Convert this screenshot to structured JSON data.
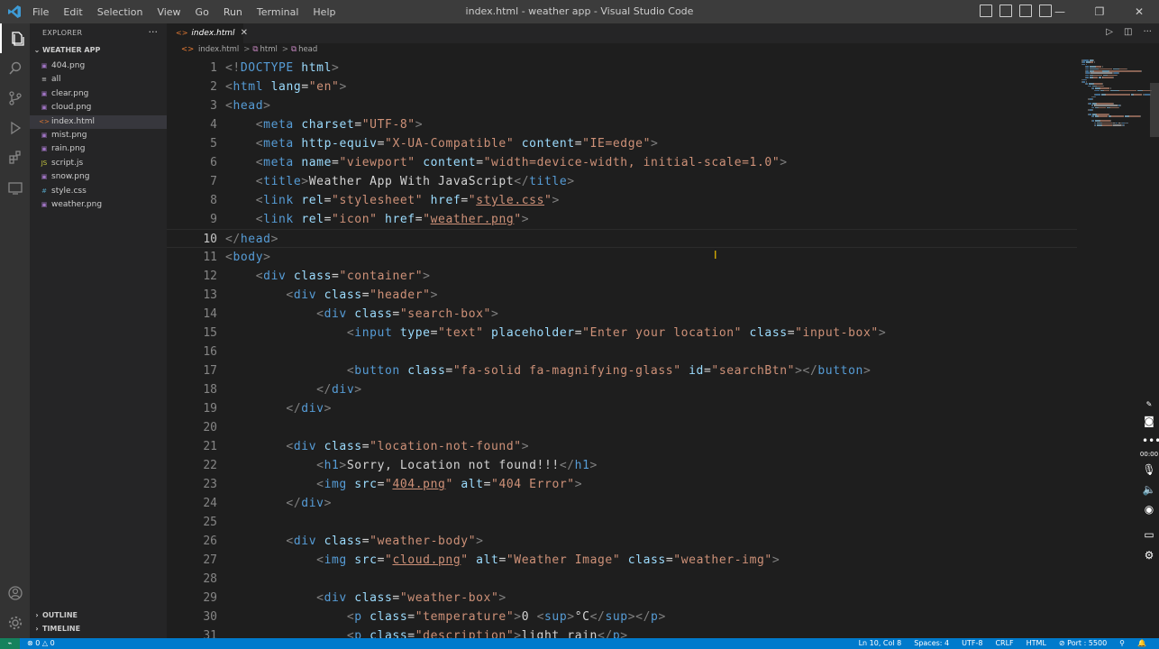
{
  "menu": [
    "File",
    "Edit",
    "Selection",
    "View",
    "Go",
    "Run",
    "Terminal",
    "Help"
  ],
  "window_title": "index.html - weather app - Visual Studio Code",
  "window_controls": {
    "minimize": "—",
    "restore": "❐",
    "close": "✕"
  },
  "sidebar": {
    "title": "EXPLORER",
    "more": "···",
    "folder": "WEATHER APP",
    "files": [
      {
        "name": "404.png",
        "icon": "▣"
      },
      {
        "name": "all",
        "icon": "≡"
      },
      {
        "name": "clear.png",
        "icon": "▣"
      },
      {
        "name": "cloud.png",
        "icon": "▣"
      },
      {
        "name": "index.html",
        "icon": "<>"
      },
      {
        "name": "mist.png",
        "icon": "▣"
      },
      {
        "name": "rain.png",
        "icon": "▣"
      },
      {
        "name": "script.js",
        "icon": "JS"
      },
      {
        "name": "snow.png",
        "icon": "▣"
      },
      {
        "name": "style.css",
        "icon": "#"
      },
      {
        "name": "weather.png",
        "icon": "▣"
      }
    ],
    "outline": "OUTLINE",
    "timeline": "TIMELINE"
  },
  "tab": {
    "label": "index.html",
    "icon": "<>",
    "close": "✕"
  },
  "breadcrumb": {
    "file": "index.html",
    "sep": ">",
    "b1": "html",
    "b2": "head"
  },
  "code_lines": [
    {
      "n": "1",
      "tokens": [
        [
          "p",
          "<!"
        ],
        [
          "t",
          "DOCTYPE"
        ],
        [
          "x",
          " "
        ],
        [
          "a",
          "html"
        ],
        [
          "p",
          ">"
        ]
      ]
    },
    {
      "n": "2",
      "tokens": [
        [
          "p",
          "<"
        ],
        [
          "t",
          "html"
        ],
        [
          "x",
          " "
        ],
        [
          "a",
          "lang"
        ],
        [
          "x",
          "="
        ],
        [
          "s",
          "\"en\""
        ],
        [
          "p",
          ">"
        ]
      ]
    },
    {
      "n": "3",
      "tokens": [
        [
          "p",
          "<"
        ],
        [
          "t",
          "head"
        ],
        [
          "p",
          ">"
        ]
      ]
    },
    {
      "n": "4",
      "tokens": [
        [
          "x",
          "    "
        ],
        [
          "p",
          "<"
        ],
        [
          "t",
          "meta"
        ],
        [
          "x",
          " "
        ],
        [
          "a",
          "charset"
        ],
        [
          "x",
          "="
        ],
        [
          "s",
          "\"UTF-8\""
        ],
        [
          "p",
          ">"
        ]
      ]
    },
    {
      "n": "5",
      "tokens": [
        [
          "x",
          "    "
        ],
        [
          "p",
          "<"
        ],
        [
          "t",
          "meta"
        ],
        [
          "x",
          " "
        ],
        [
          "a",
          "http-equiv"
        ],
        [
          "x",
          "="
        ],
        [
          "s",
          "\"X-UA-Compatible\""
        ],
        [
          "x",
          " "
        ],
        [
          "a",
          "content"
        ],
        [
          "x",
          "="
        ],
        [
          "s",
          "\"IE=edge\""
        ],
        [
          "p",
          ">"
        ]
      ]
    },
    {
      "n": "6",
      "tokens": [
        [
          "x",
          "    "
        ],
        [
          "p",
          "<"
        ],
        [
          "t",
          "meta"
        ],
        [
          "x",
          " "
        ],
        [
          "a",
          "name"
        ],
        [
          "x",
          "="
        ],
        [
          "s",
          "\"viewport\""
        ],
        [
          "x",
          " "
        ],
        [
          "a",
          "content"
        ],
        [
          "x",
          "="
        ],
        [
          "s",
          "\"width=device-width, initial-scale=1.0\""
        ],
        [
          "p",
          ">"
        ]
      ]
    },
    {
      "n": "7",
      "tokens": [
        [
          "x",
          "    "
        ],
        [
          "p",
          "<"
        ],
        [
          "t",
          "title"
        ],
        [
          "p",
          ">"
        ],
        [
          "x",
          "Weather App With JavaScript"
        ],
        [
          "p",
          "</"
        ],
        [
          "t",
          "title"
        ],
        [
          "p",
          ">"
        ]
      ]
    },
    {
      "n": "8",
      "tokens": [
        [
          "x",
          "    "
        ],
        [
          "p",
          "<"
        ],
        [
          "t",
          "link"
        ],
        [
          "x",
          " "
        ],
        [
          "a",
          "rel"
        ],
        [
          "x",
          "="
        ],
        [
          "s",
          "\"stylesheet\""
        ],
        [
          "x",
          " "
        ],
        [
          "a",
          "href"
        ],
        [
          "x",
          "="
        ],
        [
          "s",
          "\""
        ],
        [
          "u",
          "style.css"
        ],
        [
          "s",
          "\""
        ],
        [
          "p",
          ">"
        ]
      ]
    },
    {
      "n": "9",
      "tokens": [
        [
          "x",
          "    "
        ],
        [
          "p",
          "<"
        ],
        [
          "t",
          "link"
        ],
        [
          "x",
          " "
        ],
        [
          "a",
          "rel"
        ],
        [
          "x",
          "="
        ],
        [
          "s",
          "\"icon\""
        ],
        [
          "x",
          " "
        ],
        [
          "a",
          "href"
        ],
        [
          "x",
          "="
        ],
        [
          "s",
          "\""
        ],
        [
          "u",
          "weather.png"
        ],
        [
          "s",
          "\""
        ],
        [
          "p",
          ">"
        ]
      ]
    },
    {
      "n": "10",
      "tokens": [
        [
          "p",
          "</"
        ],
        [
          "t",
          "head"
        ],
        [
          "p",
          ">"
        ]
      ]
    },
    {
      "n": "11",
      "tokens": [
        [
          "p",
          "<"
        ],
        [
          "t",
          "body"
        ],
        [
          "p",
          ">"
        ]
      ]
    },
    {
      "n": "12",
      "tokens": [
        [
          "x",
          "    "
        ],
        [
          "p",
          "<"
        ],
        [
          "t",
          "div"
        ],
        [
          "x",
          " "
        ],
        [
          "a",
          "class"
        ],
        [
          "x",
          "="
        ],
        [
          "s",
          "\"container\""
        ],
        [
          "p",
          ">"
        ]
      ]
    },
    {
      "n": "13",
      "tokens": [
        [
          "x",
          "        "
        ],
        [
          "p",
          "<"
        ],
        [
          "t",
          "div"
        ],
        [
          "x",
          " "
        ],
        [
          "a",
          "class"
        ],
        [
          "x",
          "="
        ],
        [
          "s",
          "\"header\""
        ],
        [
          "p",
          ">"
        ]
      ]
    },
    {
      "n": "14",
      "tokens": [
        [
          "x",
          "            "
        ],
        [
          "p",
          "<"
        ],
        [
          "t",
          "div"
        ],
        [
          "x",
          " "
        ],
        [
          "a",
          "class"
        ],
        [
          "x",
          "="
        ],
        [
          "s",
          "\"search-box\""
        ],
        [
          "p",
          ">"
        ]
      ]
    },
    {
      "n": "15",
      "tokens": [
        [
          "x",
          "                "
        ],
        [
          "p",
          "<"
        ],
        [
          "t",
          "input"
        ],
        [
          "x",
          " "
        ],
        [
          "a",
          "type"
        ],
        [
          "x",
          "="
        ],
        [
          "s",
          "\"text\""
        ],
        [
          "x",
          " "
        ],
        [
          "a",
          "placeholder"
        ],
        [
          "x",
          "="
        ],
        [
          "s",
          "\"Enter your location\""
        ],
        [
          "x",
          " "
        ],
        [
          "a",
          "class"
        ],
        [
          "x",
          "="
        ],
        [
          "s",
          "\"input-box\""
        ],
        [
          "p",
          ">"
        ]
      ]
    },
    {
      "n": "16",
      "tokens": []
    },
    {
      "n": "17",
      "tokens": [
        [
          "x",
          "                "
        ],
        [
          "p",
          "<"
        ],
        [
          "t",
          "button"
        ],
        [
          "x",
          " "
        ],
        [
          "a",
          "class"
        ],
        [
          "x",
          "="
        ],
        [
          "s",
          "\"fa-solid fa-magnifying-glass\""
        ],
        [
          "x",
          " "
        ],
        [
          "a",
          "id"
        ],
        [
          "x",
          "="
        ],
        [
          "s",
          "\"searchBtn\""
        ],
        [
          "p",
          "></"
        ],
        [
          "t",
          "button"
        ],
        [
          "p",
          ">"
        ]
      ]
    },
    {
      "n": "18",
      "tokens": [
        [
          "x",
          "            "
        ],
        [
          "p",
          "</"
        ],
        [
          "t",
          "div"
        ],
        [
          "p",
          ">"
        ]
      ]
    },
    {
      "n": "19",
      "tokens": [
        [
          "x",
          "        "
        ],
        [
          "p",
          "</"
        ],
        [
          "t",
          "div"
        ],
        [
          "p",
          ">"
        ]
      ]
    },
    {
      "n": "20",
      "tokens": []
    },
    {
      "n": "21",
      "tokens": [
        [
          "x",
          "        "
        ],
        [
          "p",
          "<"
        ],
        [
          "t",
          "div"
        ],
        [
          "x",
          " "
        ],
        [
          "a",
          "class"
        ],
        [
          "x",
          "="
        ],
        [
          "s",
          "\"location-not-found\""
        ],
        [
          "p",
          ">"
        ]
      ]
    },
    {
      "n": "22",
      "tokens": [
        [
          "x",
          "            "
        ],
        [
          "p",
          "<"
        ],
        [
          "t",
          "h1"
        ],
        [
          "p",
          ">"
        ],
        [
          "x",
          "Sorry, Location not found!!!"
        ],
        [
          "p",
          "</"
        ],
        [
          "t",
          "h1"
        ],
        [
          "p",
          ">"
        ]
      ]
    },
    {
      "n": "23",
      "tokens": [
        [
          "x",
          "            "
        ],
        [
          "p",
          "<"
        ],
        [
          "t",
          "img"
        ],
        [
          "x",
          " "
        ],
        [
          "a",
          "src"
        ],
        [
          "x",
          "="
        ],
        [
          "s",
          "\""
        ],
        [
          "u",
          "404.png"
        ],
        [
          "s",
          "\""
        ],
        [
          "x",
          " "
        ],
        [
          "a",
          "alt"
        ],
        [
          "x",
          "="
        ],
        [
          "s",
          "\"404 Error\""
        ],
        [
          "p",
          ">"
        ]
      ]
    },
    {
      "n": "24",
      "tokens": [
        [
          "x",
          "        "
        ],
        [
          "p",
          "</"
        ],
        [
          "t",
          "div"
        ],
        [
          "p",
          ">"
        ]
      ]
    },
    {
      "n": "25",
      "tokens": []
    },
    {
      "n": "26",
      "tokens": [
        [
          "x",
          "        "
        ],
        [
          "p",
          "<"
        ],
        [
          "t",
          "div"
        ],
        [
          "x",
          " "
        ],
        [
          "a",
          "class"
        ],
        [
          "x",
          "="
        ],
        [
          "s",
          "\"weather-body\""
        ],
        [
          "p",
          ">"
        ]
      ]
    },
    {
      "n": "27",
      "tokens": [
        [
          "x",
          "            "
        ],
        [
          "p",
          "<"
        ],
        [
          "t",
          "img"
        ],
        [
          "x",
          " "
        ],
        [
          "a",
          "src"
        ],
        [
          "x",
          "="
        ],
        [
          "s",
          "\""
        ],
        [
          "u",
          "cloud.png"
        ],
        [
          "s",
          "\""
        ],
        [
          "x",
          " "
        ],
        [
          "a",
          "alt"
        ],
        [
          "x",
          "="
        ],
        [
          "s",
          "\"Weather Image\""
        ],
        [
          "x",
          " "
        ],
        [
          "a",
          "class"
        ],
        [
          "x",
          "="
        ],
        [
          "s",
          "\"weather-img\""
        ],
        [
          "p",
          ">"
        ]
      ]
    },
    {
      "n": "28",
      "tokens": []
    },
    {
      "n": "29",
      "tokens": [
        [
          "x",
          "            "
        ],
        [
          "p",
          "<"
        ],
        [
          "t",
          "div"
        ],
        [
          "x",
          " "
        ],
        [
          "a",
          "class"
        ],
        [
          "x",
          "="
        ],
        [
          "s",
          "\"weather-box\""
        ],
        [
          "p",
          ">"
        ]
      ]
    },
    {
      "n": "30",
      "tokens": [
        [
          "x",
          "                "
        ],
        [
          "p",
          "<"
        ],
        [
          "t",
          "p"
        ],
        [
          "x",
          " "
        ],
        [
          "a",
          "class"
        ],
        [
          "x",
          "="
        ],
        [
          "s",
          "\"temperature\""
        ],
        [
          "p",
          ">"
        ],
        [
          "x",
          "0 "
        ],
        [
          "p",
          "<"
        ],
        [
          "t",
          "sup"
        ],
        [
          "p",
          ">"
        ],
        [
          "x",
          "°C"
        ],
        [
          "p",
          "</"
        ],
        [
          "t",
          "sup"
        ],
        [
          "p",
          "></"
        ],
        [
          "t",
          "p"
        ],
        [
          "p",
          ">"
        ]
      ]
    },
    {
      "n": "31",
      "tokens": [
        [
          "x",
          "                "
        ],
        [
          "p",
          "<"
        ],
        [
          "t",
          "p"
        ],
        [
          "x",
          " "
        ],
        [
          "a",
          "class"
        ],
        [
          "x",
          "="
        ],
        [
          "s",
          "\"description\""
        ],
        [
          "p",
          ">"
        ],
        [
          "x",
          "light rain"
        ],
        [
          "p",
          "</"
        ],
        [
          "t",
          "p"
        ],
        [
          "p",
          ">"
        ]
      ]
    }
  ],
  "active_line": "10",
  "floating_toolbar": [
    "00:00"
  ],
  "status": {
    "remote": "⌁",
    "problems": "⊗ 0 △ 0",
    "position": "Ln 10, Col 8",
    "spaces": "Spaces: 4",
    "encoding": "UTF-8",
    "eol": "CRLF",
    "language": "HTML",
    "port": "⊘ Port : 5500",
    "account": "⚲",
    "bell": "🔔"
  },
  "colors": {
    "accent": "#007acc",
    "tag": "#569cd6",
    "attr": "#9cdcfe",
    "string": "#ce9178",
    "text": "#d4d4d4"
  }
}
